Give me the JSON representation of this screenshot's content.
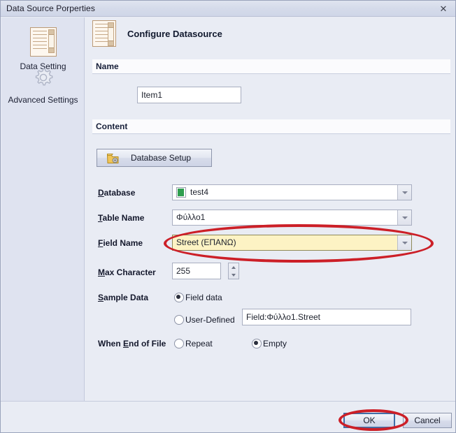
{
  "window": {
    "title": "Data Source Porperties",
    "close_icon": "close-icon",
    "close_glyph": "✕"
  },
  "sidebar": {
    "items": [
      {
        "label": "Data Setting",
        "icon": "document-list-icon",
        "selected": true
      },
      {
        "label": "Advanced Settings",
        "icon": "gear-icon",
        "selected": false
      }
    ]
  },
  "header": {
    "title": "Configure Datasource",
    "icon": "document-list-icon"
  },
  "sections": {
    "name": {
      "title": "Name"
    },
    "content": {
      "title": "Content"
    }
  },
  "fields": {
    "name_input": {
      "value": "Item1",
      "placeholder": ""
    },
    "database_setup_button": {
      "label": "Database Setup",
      "icon": "database-gear-icon"
    },
    "database": {
      "label_prefix": "D",
      "label_rest": "atabase",
      "value": "test4",
      "icon": "excel-file-icon",
      "arrow_icon": "chevron-down-icon"
    },
    "table_name": {
      "label_prefix": "T",
      "label_rest": "able Name",
      "value": "Φύλλο1",
      "arrow_icon": "chevron-down-icon"
    },
    "field_name": {
      "label_prefix": "F",
      "label_rest": "ield Name",
      "value": "Street  (ΕΠΑΝΩ)",
      "arrow_icon": "chevron-down-icon",
      "highlighted": true,
      "highlight_color": "#fdf3c4"
    },
    "max_character": {
      "label_prefix": "M",
      "label_rest": "ax Character",
      "value": "255",
      "up_icon": "spinner-up-icon",
      "down_icon": "spinner-down-icon"
    },
    "sample_data": {
      "label_prefix": "S",
      "label_rest": "ample Data",
      "options": [
        {
          "label": "Field data",
          "selected": true
        },
        {
          "label": "User-Defined",
          "selected": false
        }
      ],
      "user_defined_value": "Field:Φύλλο1.Street"
    },
    "when_end_of_file": {
      "label_pre": "When ",
      "label_mn": "E",
      "label_post": "nd of File",
      "options": [
        {
          "label": "Repeat",
          "selected": false
        },
        {
          "label": "Empty",
          "selected": true
        }
      ]
    }
  },
  "footer": {
    "ok_label": "OK",
    "cancel_label": "Cancel"
  },
  "annotations": {
    "color": "#cc1f27",
    "shapes": [
      {
        "name": "ellipse-around-field-name",
        "target": "field_name"
      },
      {
        "name": "ellipse-around-ok-button",
        "target": "ok_button"
      }
    ]
  }
}
